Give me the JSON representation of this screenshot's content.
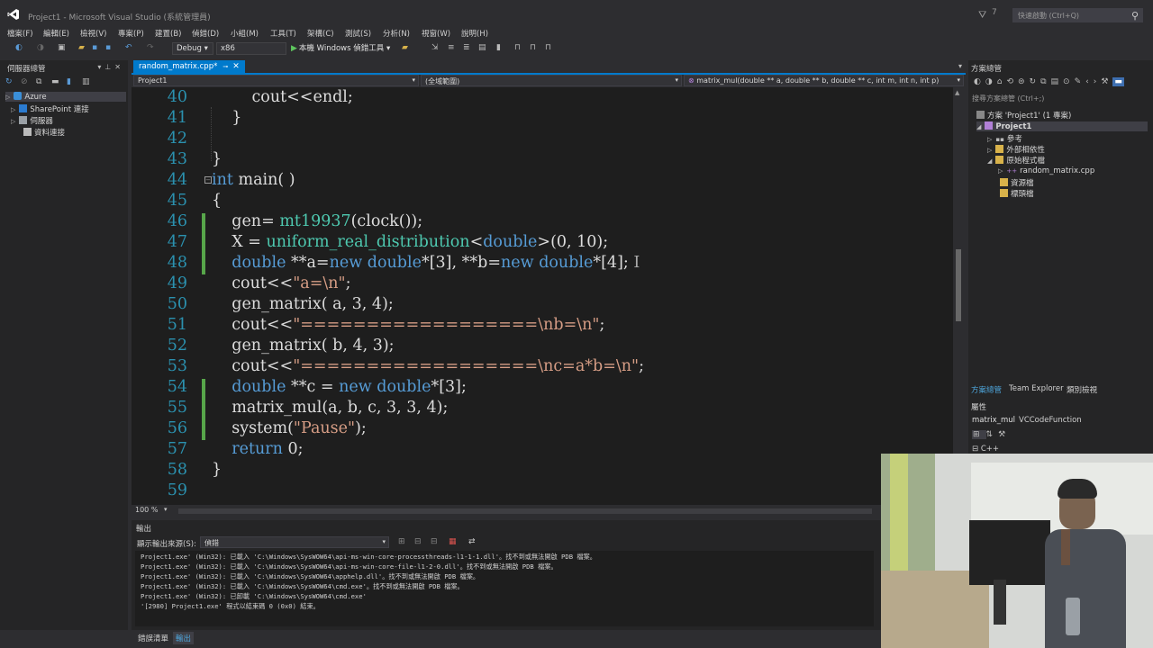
{
  "window": {
    "title": "Project1 - Microsoft Visual Studio (系統管理員)",
    "flag_count": "7",
    "quick_launch_placeholder": "快速啟動 (Ctrl+Q)"
  },
  "menu": [
    "檔案(F)",
    "編輯(E)",
    "檢視(V)",
    "專案(P)",
    "建置(B)",
    "偵錯(D)",
    "小組(M)",
    "工具(T)",
    "架構(C)",
    "測試(S)",
    "分析(N)",
    "視窗(W)",
    "說明(H)"
  ],
  "toolbar": {
    "config": "Debug",
    "platform": "x86",
    "run_label": "本機 Windows 偵錯工具"
  },
  "server_explorer": {
    "title": "伺服器總管",
    "items": [
      "Azure",
      "SharePoint 連接",
      "伺服器",
      "資料連接"
    ]
  },
  "editor": {
    "tab_label": "random_matrix.cpp*",
    "nav_project": "Project1",
    "nav_scope": "(全域範圍)",
    "nav_member": "matrix_mul(double ** a, double ** b, double ** c, int m, int n, int p)",
    "zoom": "100 %",
    "line_numbers": [
      "40",
      "41",
      "42",
      "43",
      "44",
      "45",
      "46",
      "47",
      "48",
      "49",
      "50",
      "51",
      "52",
      "53",
      "54",
      "55",
      "56",
      "57",
      "58",
      "59"
    ]
  },
  "output": {
    "title": "輸出",
    "source_label": "顯示輸出來源(S):",
    "source_value": "偵錯",
    "lines": [
      "Project1.exe' (Win32): 已載入 'C:\\Windows\\SysWOW64\\api-ms-win-core-processthreads-l1-1-1.dll'。找不到或無法開啟 PDB 檔案。",
      "Project1.exe' (Win32): 已載入 'C:\\Windows\\SysWOW64\\api-ms-win-core-file-l1-2-0.dll'。找不到或無法開啟 PDB 檔案。",
      "Project1.exe' (Win32): 已載入 'C:\\Windows\\SysWOW64\\apphelp.dll'。找不到或無法開啟 PDB 檔案。",
      "Project1.exe' (Win32): 已載入 'C:\\Windows\\SysWOW64\\cmd.exe'。找不到或無法開啟 PDB 檔案。",
      "Project1.exe' (Win32): 已卸載 'C:\\Windows\\SysWOW64\\cmd.exe'",
      "'[2980] Project1.exe' 程式以結束碼 0 (0x0) 結束。"
    ]
  },
  "bottom_tabs": [
    "錯誤清單",
    "輸出"
  ],
  "solution_explorer": {
    "title": "方案總管",
    "search_placeholder": "搜尋方案總管 (Ctrl+;)",
    "solution": "方案 'Project1' (1 專案)",
    "project": "Project1",
    "references": "參考",
    "external_deps": "外部相依性",
    "source_files": "原始程式檔",
    "cpp_file": "random_matrix.cpp",
    "resource_files": "資源檔",
    "header_files": "標頭檔",
    "tabs": [
      "方案總管",
      "Team Explorer",
      "類別檢視"
    ]
  },
  "properties": {
    "title": "屬性",
    "object_name": "matrix_mul",
    "object_type": "VCCodeFunction",
    "category": "C++"
  },
  "colors": {
    "accent": "#007acc",
    "editor_bg": "#1e1e1e",
    "line_number": "#2b91af",
    "keyword": "#569cd6",
    "type": "#4ec9b0",
    "string": "#d69d85",
    "change_bar": "#57a64a"
  }
}
